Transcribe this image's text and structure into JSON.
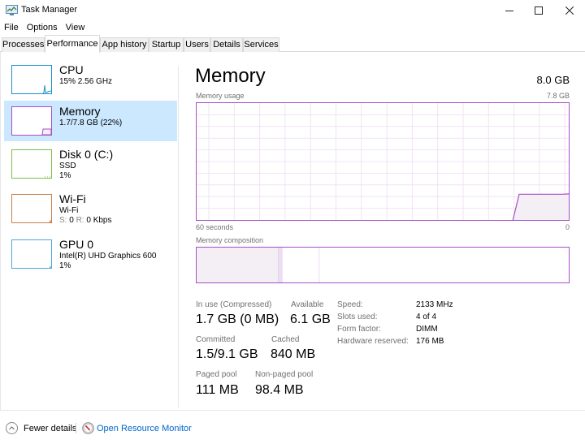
{
  "window": {
    "title": "Task Manager",
    "controls": {
      "minimize": "—",
      "maximize": "☐",
      "close": "✕"
    }
  },
  "menu": [
    "File",
    "Options",
    "View"
  ],
  "tabs": [
    {
      "label": "Processes",
      "active": false
    },
    {
      "label": "Performance",
      "active": true
    },
    {
      "label": "App history",
      "active": false
    },
    {
      "label": "Startup",
      "active": false
    },
    {
      "label": "Users",
      "active": false
    },
    {
      "label": "Details",
      "active": false
    },
    {
      "label": "Services",
      "active": false
    }
  ],
  "sidebar": {
    "items": [
      {
        "title": "CPU",
        "sub1": "15% 2.56 GHz",
        "sub2": "",
        "color": "#1e8fca",
        "selected": false
      },
      {
        "title": "Memory",
        "sub1": "1.7/7.8 GB (22%)",
        "sub2": "",
        "color": "#a64ec9",
        "selected": true
      },
      {
        "title": "Disk 0 (C:)",
        "sub1": "SSD",
        "sub2": "1%",
        "color": "#7cbf45",
        "selected": false
      },
      {
        "title": "Wi-Fi",
        "sub1": "Wi-Fi",
        "sub2_s_label": "S:",
        "sub2_s": "0",
        "sub2_r_label": "R:",
        "sub2_r": "0 Kbps",
        "color": "#c7804a",
        "selected": false
      },
      {
        "title": "GPU 0",
        "sub1": "Intel(R) UHD Graphics 600",
        "sub2": "1%",
        "color": "#4ea6d9",
        "selected": false
      }
    ]
  },
  "main": {
    "title": "Memory",
    "total": "8.0 GB",
    "usage_label": "Memory usage",
    "usage_max": "7.8 GB",
    "time_left": "60 seconds",
    "time_right": "0",
    "composition_label": "Memory composition",
    "usage_series_fraction": [
      0,
      0,
      0,
      0,
      0,
      0,
      0,
      0,
      0,
      0,
      0,
      0,
      0,
      0,
      0,
      0,
      0,
      0,
      0,
      0,
      0,
      0,
      0,
      0,
      0,
      0,
      0,
      0,
      0,
      0,
      0,
      0,
      0,
      0,
      0,
      0,
      0,
      0,
      0,
      0,
      0,
      0,
      0,
      0,
      0,
      0,
      0,
      0,
      0,
      0,
      0,
      0,
      0.22,
      0.22,
      0.22,
      0.22,
      0.22,
      0.22,
      0.22,
      0.22,
      0.223
    ],
    "composition_fraction": {
      "in_use": 0.22,
      "modified": 0.01,
      "standby": 0.1,
      "free": 0.67
    },
    "colors": {
      "accent": "#a64ec9",
      "grid": "#f1e2f6",
      "fill": "#f3eff5"
    }
  },
  "stats": {
    "in_use_label": "In use (Compressed)",
    "in_use_value": "1.7 GB (0 MB)",
    "available_label": "Available",
    "available_value": "6.1 GB",
    "committed_label": "Committed",
    "committed_value": "1.5/9.1 GB",
    "cached_label": "Cached",
    "cached_value": "840 MB",
    "paged_label": "Paged pool",
    "paged_value": "111 MB",
    "nonpaged_label": "Non-paged pool",
    "nonpaged_value": "98.4 MB"
  },
  "specs": [
    {
      "label": "Speed:",
      "value": "2133 MHz"
    },
    {
      "label": "Slots used:",
      "value": "4 of 4"
    },
    {
      "label": "Form factor:",
      "value": "DIMM"
    },
    {
      "label": "Hardware reserved:",
      "value": "176 MB"
    }
  ],
  "footer": {
    "fewer_details": "Fewer details",
    "open_resource_monitor": "Open Resource Monitor"
  }
}
